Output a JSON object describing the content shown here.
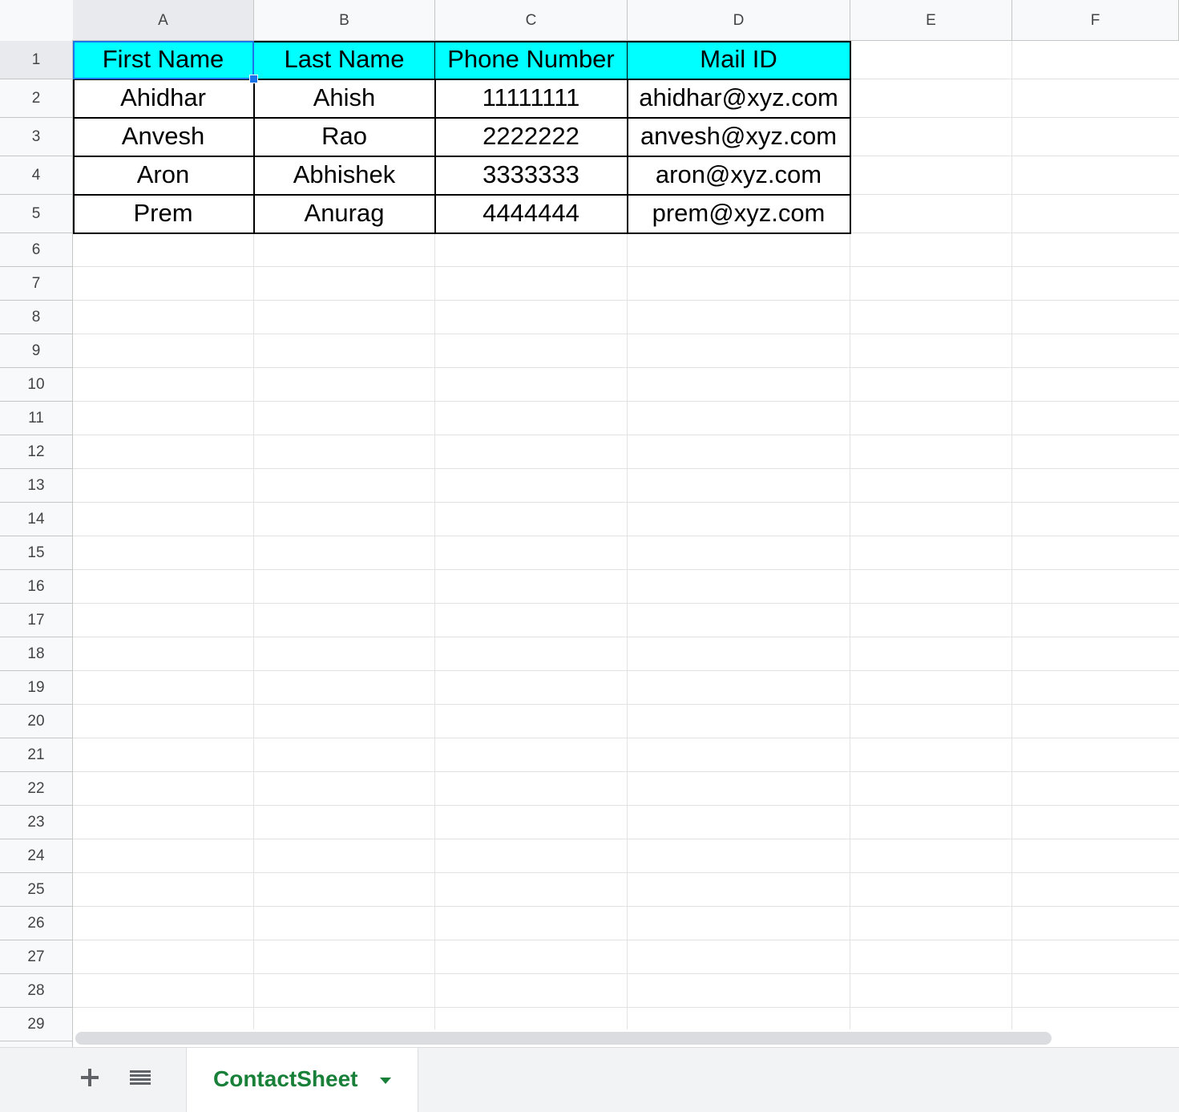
{
  "columns": [
    "A",
    "B",
    "C",
    "D",
    "E",
    "F"
  ],
  "rows": [
    "1",
    "2",
    "3",
    "4",
    "5",
    "6",
    "7",
    "8",
    "9",
    "10",
    "11",
    "12",
    "13",
    "14",
    "15",
    "16",
    "17",
    "18",
    "19",
    "20",
    "21",
    "22",
    "23",
    "24",
    "25",
    "26",
    "27",
    "28",
    "29"
  ],
  "table": {
    "header": [
      "First Name",
      "Last Name",
      "Phone Number",
      "Mail ID"
    ],
    "rows": [
      [
        "Ahidhar",
        "Ahish",
        "11111111",
        "ahidhar@xyz.com"
      ],
      [
        "Anvesh",
        "Rao",
        "2222222",
        "anvesh@xyz.com"
      ],
      [
        "Aron",
        "Abhishek",
        "3333333",
        "aron@xyz.com"
      ],
      [
        "Prem",
        "Anurag",
        "4444444",
        "prem@xyz.com"
      ]
    ]
  },
  "selected_cell": "A1",
  "colors": {
    "header_fill": "#00ffff",
    "selection": "#1a73e8",
    "active_tab_text": "#188038"
  },
  "footer": {
    "add_sheet_icon": "plus-icon",
    "all_sheets_icon": "list-icon",
    "active_sheet": "ContactSheet"
  }
}
